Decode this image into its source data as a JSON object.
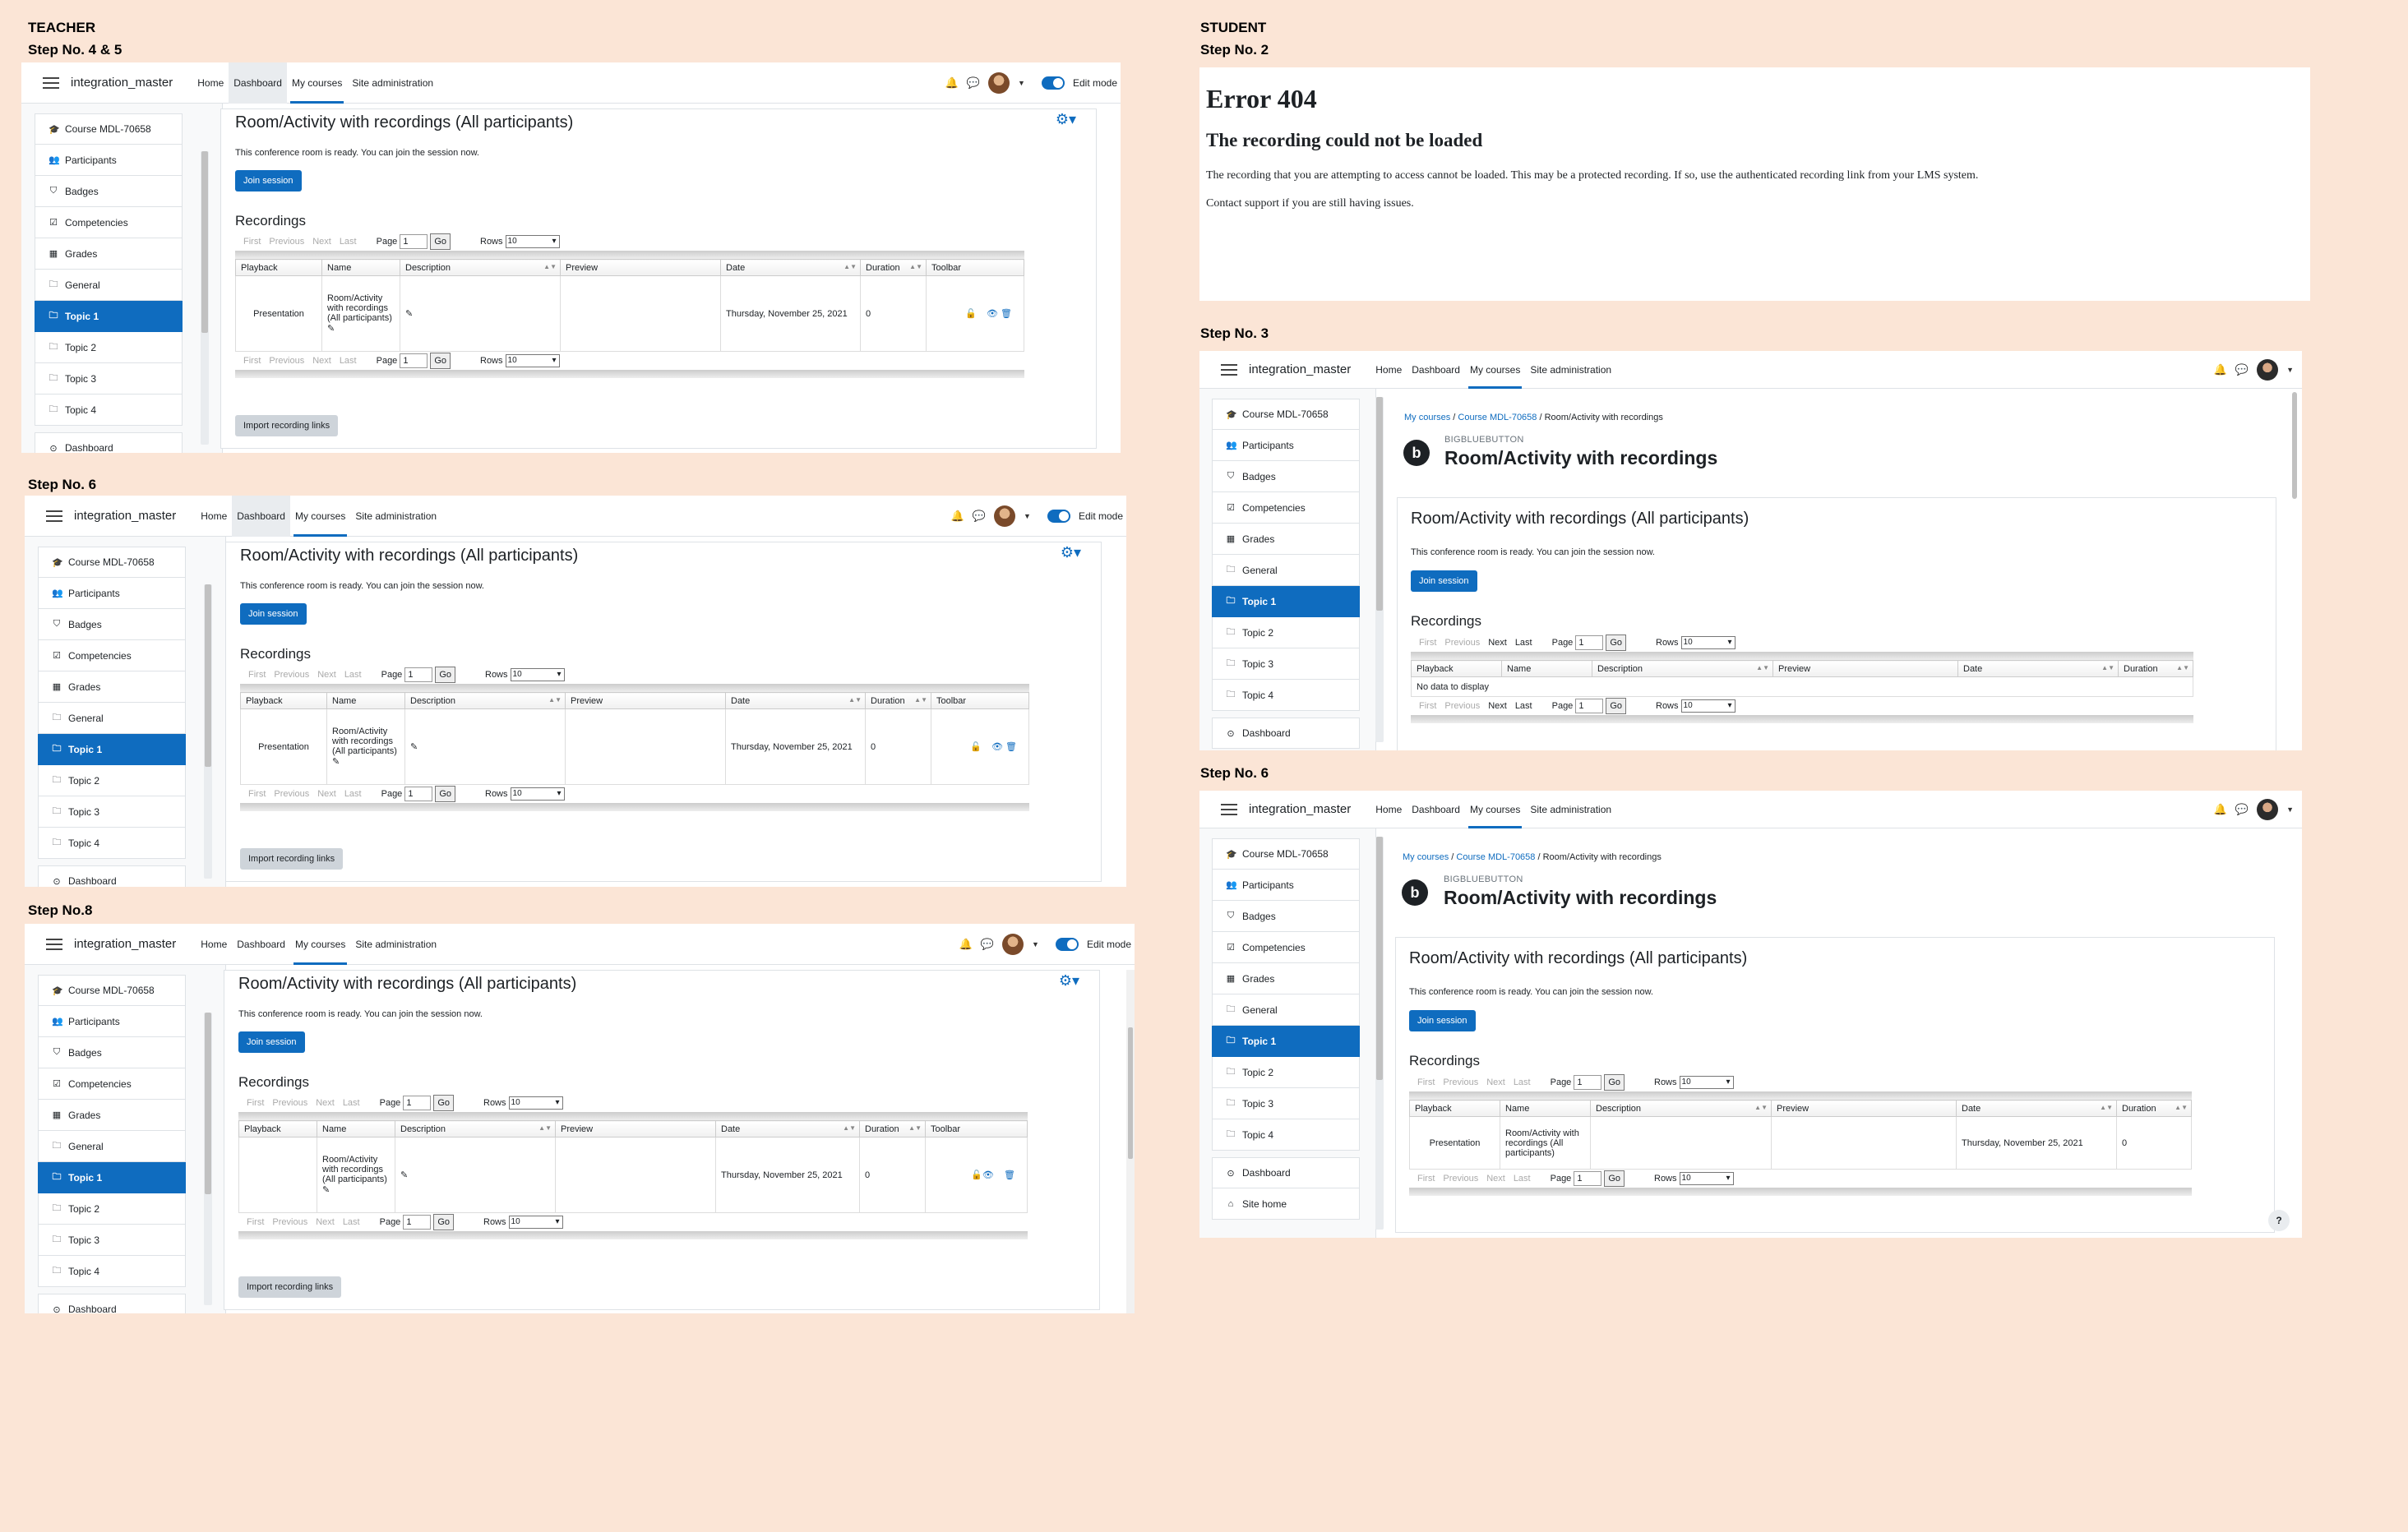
{
  "labels": {
    "teacher": "TEACHER",
    "step45": "Step No.  4 & 5",
    "step6t": "Step No. 6",
    "step8": "Step No.8",
    "student": "STUDENT",
    "step2": "Step No.  2",
    "step3": "Step No. 3",
    "step6s": "Step No. 6"
  },
  "nav": {
    "brand": "integration_master",
    "home": "Home",
    "dashboard": "Dashboard",
    "mycourses": "My courses",
    "siteadmin": "Site administration",
    "editmode": "Edit mode"
  },
  "drawer": {
    "course": "Course MDL-70658",
    "participants": "Participants",
    "badges": "Badges",
    "competencies": "Competencies",
    "grades": "Grades",
    "general": "General",
    "topic1": "Topic 1",
    "topic2": "Topic 2",
    "topic3": "Topic 3",
    "topic4": "Topic 4",
    "dashboard": "Dashboard",
    "sitehome": "Site home"
  },
  "room": {
    "title": "Room/Activity with recordings (All participants)",
    "ready": "This conference room is ready. You can join the session now.",
    "join": "Join session",
    "recordings": "Recordings",
    "import": "Import recording links"
  },
  "pager": {
    "first": "First",
    "previous": "Previous",
    "next": "Next",
    "last": "Last",
    "page": "Page",
    "page_value": "1",
    "go": "Go",
    "rows": "Rows",
    "rows_value": "10"
  },
  "table": {
    "headers": [
      "Playback",
      "Name",
      "Description",
      "Preview",
      "Date",
      "Duration",
      "Toolbar"
    ],
    "playback": "Presentation",
    "name": "Room/Activity with recordings (All participants)",
    "date": "Thursday, November 25, 2021",
    "duration": "0",
    "nodata": "No data to display"
  },
  "error": {
    "code": "Error 404",
    "heading": "The recording could not be loaded",
    "body": "The recording that you are attempting to access cannot be loaded. This may be a protected recording. If so, use the authenticated recording link from your LMS system.",
    "support": "Contact support if you are still having issues."
  },
  "student": {
    "crumb1": "My courses",
    "crumb2": "Course MDL-70658",
    "crumb3": "Room/Activity with recordings",
    "modname": "BIGBLUEBUTTON",
    "activity": "Room/Activity with recordings",
    "help": "?"
  }
}
